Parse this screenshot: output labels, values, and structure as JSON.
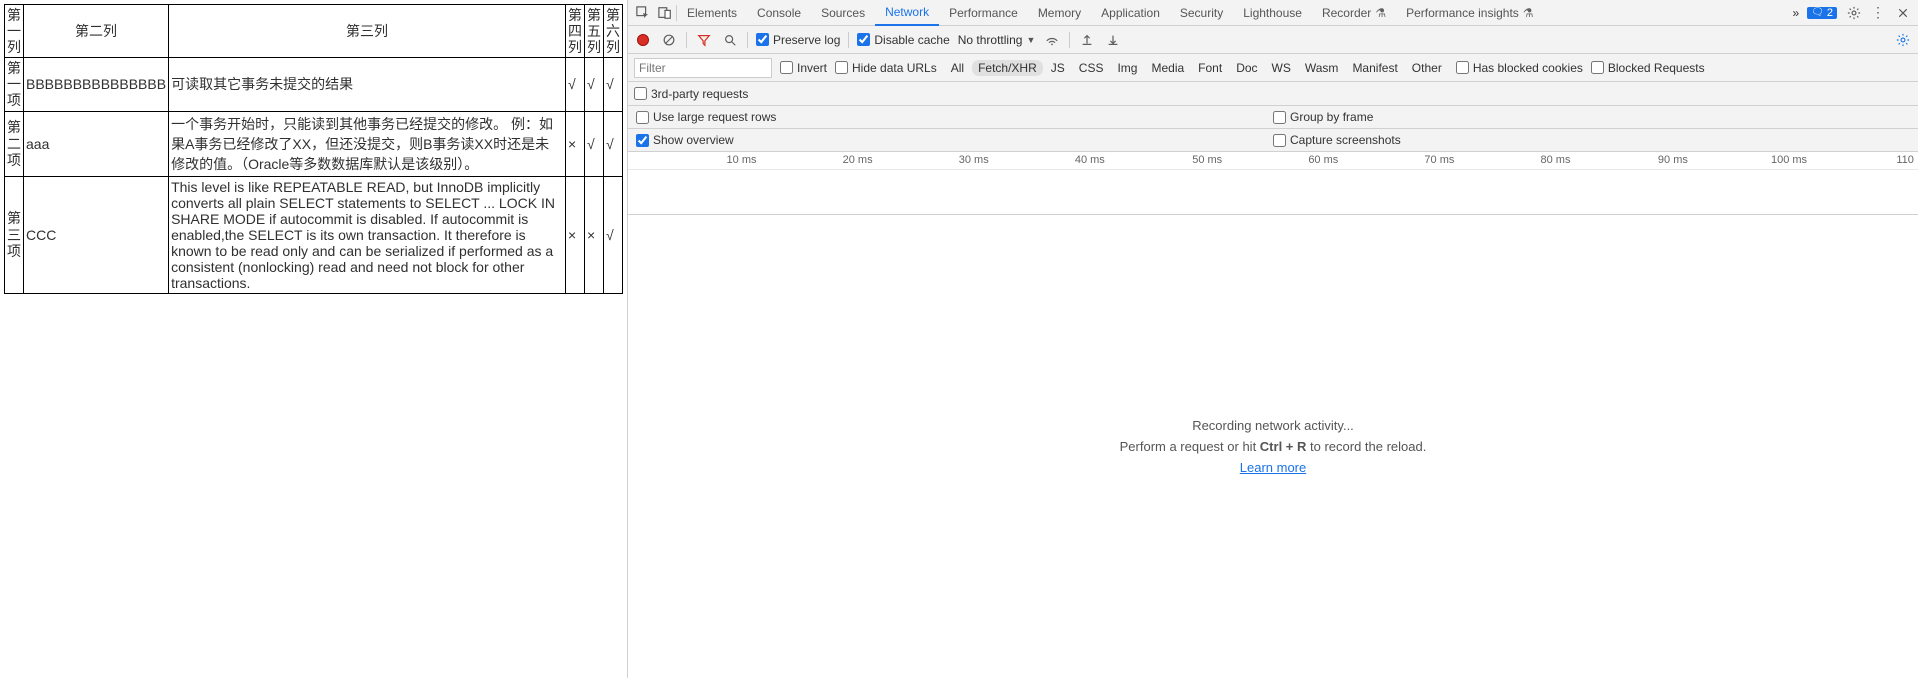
{
  "table": {
    "headers": [
      "第一列",
      "第二列",
      "第三列",
      "第四列",
      "第五列",
      "第六列"
    ],
    "rows": [
      {
        "c1": "第一项",
        "c2": "BBBBBBBBBBBBBBB",
        "c3": "可读取其它事务未提交的结果",
        "c4": "√",
        "c5": "√",
        "c6": "√"
      },
      {
        "c1": "第二项",
        "c2": "aaa",
        "c3": "一个事务开始时，只能读到其他事务已经提交的修改。 例：如果A事务已经修改了XX，但还没提交，则B事务读XX时还是未修改的值。（Oracle等多数数据库默认是该级别）。",
        "c4": "×",
        "c5": "√",
        "c6": "√"
      },
      {
        "c1": "第三项",
        "c2": "CCC",
        "c3": "This level is like REPEATABLE READ, but InnoDB implicitly converts all plain SELECT statements to SELECT ... LOCK IN SHARE MODE if autocommit is disabled. If autocommit is enabled,the SELECT is its own transaction. It therefore is known to be read only and can be serialized if performed as a consistent (nonlocking) read and need not block for other transactions.",
        "c4": "×",
        "c5": "×",
        "c6": "√"
      }
    ]
  },
  "devtools": {
    "tabs": [
      "Elements",
      "Console",
      "Sources",
      "Network",
      "Performance",
      "Memory",
      "Application",
      "Security",
      "Lighthouse",
      "Recorder",
      "Performance insights"
    ],
    "active_tab": "Network",
    "overflow": "»",
    "badge": "2"
  },
  "network_toolbar": {
    "preserve_log": "Preserve log",
    "disable_cache": "Disable cache",
    "throttling": "No throttling"
  },
  "filter": {
    "placeholder": "Filter",
    "invert": "Invert",
    "hide_data_urls": "Hide data URLs",
    "types": [
      "All",
      "Fetch/XHR",
      "JS",
      "CSS",
      "Img",
      "Media",
      "Font",
      "Doc",
      "WS",
      "Wasm",
      "Manifest",
      "Other"
    ],
    "selected_type": "Fetch/XHR",
    "has_blocked_cookies": "Has blocked cookies",
    "blocked_requests": "Blocked Requests",
    "third_party": "3rd-party requests"
  },
  "options": {
    "use_large_rows": "Use large request rows",
    "group_by_frame": "Group by frame",
    "show_overview": "Show overview",
    "capture_screenshots": "Capture screenshots"
  },
  "timeline": {
    "ticks": [
      "10 ms",
      "20 ms",
      "30 ms",
      "40 ms",
      "50 ms",
      "60 ms",
      "70 ms",
      "80 ms",
      "90 ms",
      "100 ms",
      "110"
    ]
  },
  "empty_state": {
    "line1": "Recording network activity...",
    "line2_a": "Perform a request or hit ",
    "line2_b": "Ctrl + R",
    "line2_c": " to record the reload.",
    "learn_more": "Learn more"
  }
}
